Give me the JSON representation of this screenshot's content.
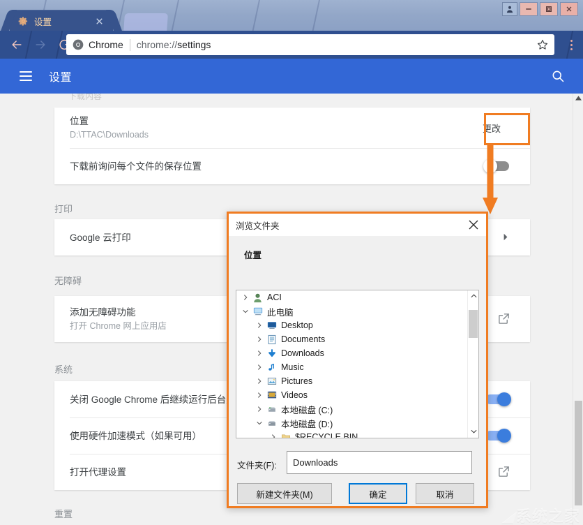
{
  "window": {
    "tab_title": "设置",
    "tab_favicon": "gear-icon",
    "buttons": {
      "user": "user-icon",
      "minimize": "—",
      "maximize": "□",
      "close": "✕"
    }
  },
  "toolbar": {
    "back": "back-arrow-icon",
    "forward": "forward-arrow-icon",
    "reload": "reload-icon",
    "omnibox": {
      "chrome_icon": "chrome-logo-icon",
      "chrome_label": "Chrome",
      "separator": "|",
      "url_prefix": "chrome://",
      "url_page": "settings",
      "star": "bookmark-star-icon"
    },
    "menu": "three-dot-menu-icon"
  },
  "settings_header": {
    "menu": "hamburger-icon",
    "title": "设置",
    "search": "search-icon"
  },
  "page": {
    "cut_text": "下载内容",
    "sections": [
      {
        "label": "",
        "rows": [
          {
            "title": "位置",
            "sub": "D:\\TTAC\\Downloads",
            "action": "更改"
          },
          {
            "title": "下载前询问每个文件的保存位置",
            "sub": "",
            "action": "toggle-off"
          }
        ]
      },
      {
        "label": "打印",
        "rows": [
          {
            "title": "Google 云打印",
            "sub": "",
            "action": "arrow"
          }
        ]
      },
      {
        "label": "无障碍",
        "rows": [
          {
            "title": "添加无障碍功能",
            "sub": "打开 Chrome 网上应用店",
            "action": "external-link"
          }
        ]
      },
      {
        "label": "系统",
        "rows": [
          {
            "title": "关闭 Google Chrome 后继续运行后台应用",
            "sub": "",
            "action": "toggle-on"
          },
          {
            "title": "使用硬件加速模式（如果可用）",
            "sub": "",
            "action": "toggle-on"
          },
          {
            "title": "打开代理设置",
            "sub": "",
            "action": "external-link"
          }
        ]
      },
      {
        "label": "重置",
        "rows": []
      }
    ],
    "labels": {
      "print": "打印",
      "accessibility": "无障碍",
      "system": "系统",
      "reset": "重置"
    },
    "change_button": "更改",
    "location_title": "位置",
    "location_value": "D:\\TTAC\\Downloads",
    "ask_where_to_save": "下载前询问每个文件的保存位置",
    "cloud_print": "Google 云打印",
    "a11y_title": "添加无障碍功能",
    "a11y_sub": "打开 Chrome 网上应用店",
    "bg_apps": "关闭 Google Chrome 后继续运行后台应用",
    "hw_accel": "使用硬件加速模式（如果可用）",
    "proxy": "打开代理设置"
  },
  "annotation": {
    "accent_color": "#f07c22",
    "target": "更改"
  },
  "dialog": {
    "title": "浏览文件夹",
    "close": "close-icon",
    "location_label": "位置",
    "tree": [
      {
        "label": "ACI",
        "icon": "user-account-icon",
        "indent": 0,
        "state": "collapsed"
      },
      {
        "label": "此电脑",
        "icon": "this-pc-icon",
        "indent": 0,
        "state": "expanded"
      },
      {
        "label": "Desktop",
        "icon": "desktop-icon",
        "indent": 1,
        "state": "collapsed"
      },
      {
        "label": "Documents",
        "icon": "documents-icon",
        "indent": 1,
        "state": "collapsed"
      },
      {
        "label": "Downloads",
        "icon": "downloads-icon",
        "indent": 1,
        "state": "collapsed"
      },
      {
        "label": "Music",
        "icon": "music-icon",
        "indent": 1,
        "state": "collapsed"
      },
      {
        "label": "Pictures",
        "icon": "pictures-icon",
        "indent": 1,
        "state": "collapsed"
      },
      {
        "label": "Videos",
        "icon": "videos-icon",
        "indent": 1,
        "state": "collapsed"
      },
      {
        "label": "本地磁盘 (C:)",
        "icon": "drive-c-icon",
        "indent": 1,
        "state": "collapsed"
      },
      {
        "label": "本地磁盘 (D:)",
        "icon": "drive-d-icon",
        "indent": 1,
        "state": "expanded"
      },
      {
        "label": "$RECYCLE.BIN",
        "icon": "folder-icon",
        "indent": 2,
        "state": "collapsed"
      }
    ],
    "folder_label": "文件夹(F):",
    "folder_value": "Downloads",
    "buttons": {
      "new_folder": "新建文件夹(M)",
      "ok": "确定",
      "cancel": "取消"
    }
  },
  "watermark": {
    "text": "系统之家"
  }
}
